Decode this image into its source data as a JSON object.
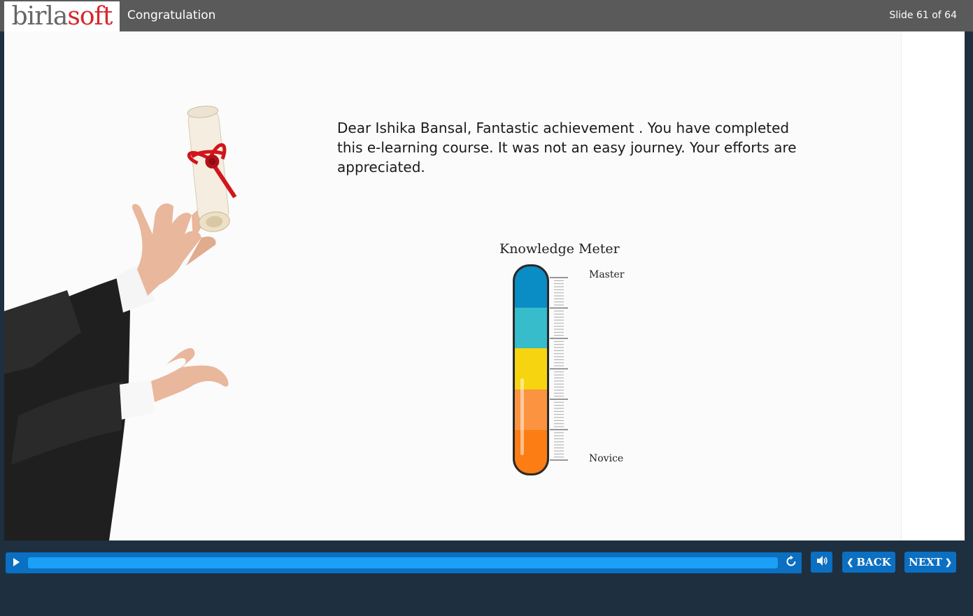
{
  "header": {
    "logo_part1": "birla",
    "logo_part2": "soft",
    "title": "Congratulation",
    "slide_counter": "Slide 61 of 64"
  },
  "content": {
    "message": "Dear Ishika Bansal, Fantastic achievement . You have completed this e-learning course. It was not an easy journey. Your efforts are appreciated."
  },
  "meter": {
    "title": "Knowledge Meter",
    "top_label": "Master",
    "bottom_label": "Novice",
    "segments": [
      "#0a8cc4",
      "#36bccb",
      "#f6d40f",
      "#fb9340",
      "#fb7d13"
    ]
  },
  "controls": {
    "progress": 1.0,
    "back_label": "BACK",
    "next_label": "NEXT",
    "accent": "#0b6fc2",
    "progress_color": "#1aa0f5"
  },
  "icons": {
    "play": "play-icon",
    "replay": "replay-icon",
    "audio": "speaker-icon",
    "back": "chevron-left-icon",
    "next": "chevron-right-icon"
  }
}
